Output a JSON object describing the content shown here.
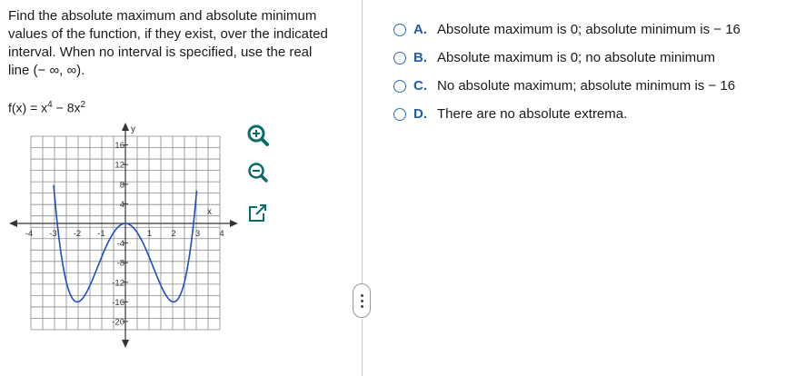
{
  "question": {
    "text": "Find the absolute maximum and absolute minimum values of the function, if they exist, over the indicated interval. When no interval is specified, use the real line (− ∞, ∞).",
    "function_lhs": "f(x) = x",
    "function_exp1": "4",
    "function_mid": " − 8x",
    "function_exp2": "2"
  },
  "graph": {
    "x_axis_label": "x",
    "y_axis_label": "y",
    "x_ticks": [
      -4,
      -3,
      -2,
      -1,
      1,
      2,
      3,
      4
    ],
    "y_ticks": [
      16,
      12,
      8,
      4,
      -4,
      -8,
      -12,
      -16,
      -20
    ],
    "x_range": [
      -4.5,
      4.5
    ],
    "y_range": [
      -22,
      18
    ],
    "curve_color": "#1f4fbf",
    "function": "x^4 - 8x^2"
  },
  "tools": {
    "zoom_in": "zoom-in-icon",
    "zoom_out": "zoom-out-icon",
    "new_window": "new-window-icon"
  },
  "options": [
    {
      "letter": "A.",
      "text": "Absolute maximum is 0; absolute minimum is  − 16"
    },
    {
      "letter": "B.",
      "text": "Absolute maximum is 0;  no absolute minimum"
    },
    {
      "letter": "C.",
      "text": "No absolute maximum; absolute minimum is  − 16"
    },
    {
      "letter": "D.",
      "text": "There are no absolute extrema."
    }
  ],
  "colors": {
    "accent": "#2a6ebb",
    "grid": "#8a8a8a",
    "divider": "#d0d0d0"
  }
}
